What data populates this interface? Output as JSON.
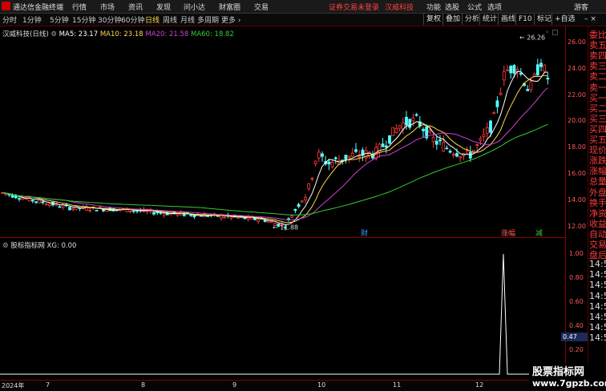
{
  "menubar": {
    "app_name": "通达信金融终端",
    "menus": [
      "行情",
      "市场",
      "资讯",
      "发现",
      "问小达",
      "财富圈",
      "交易"
    ],
    "alert": "证券交易未登录",
    "stock_link": "汉威科技",
    "right_menus": [
      "功能",
      "选股",
      "公式",
      "选项",
      "游客"
    ]
  },
  "toolbar": {
    "periods": [
      "分时",
      "1分钟",
      "5分钟",
      "15分钟",
      "30分钟",
      "60分钟",
      "日线",
      "周线",
      "月线",
      "多周期",
      "更多 ›"
    ],
    "active": "日线",
    "right_buttons": [
      "复权",
      "叠加",
      "分析",
      "统计",
      "画线",
      "F10",
      "标记",
      "+自选"
    ]
  },
  "main_chart": {
    "title": "汉威科技(日线)",
    "ma": [
      {
        "label": "MA5: 23.17",
        "color": "#ffffff"
      },
      {
        "label": "MA10: 23.18",
        "color": "#ffd84a"
      },
      {
        "label": "MA20: 21.58",
        "color": "#d040d0"
      },
      {
        "label": "MA60: 18.82",
        "color": "#33cc33"
      }
    ],
    "high_label": "26.26",
    "low_label": "11.88",
    "price_axis": [
      "26.00",
      "24.00",
      "22.00",
      "20.00",
      "18.00",
      "16.00",
      "14.00",
      "12.00"
    ],
    "markers": [
      {
        "text": "财",
        "color": "#33a0ff"
      },
      {
        "text": "涨幅",
        "color": "#ff5a5a"
      },
      {
        "text": "减",
        "color": "#33cc33"
      }
    ]
  },
  "indicator": {
    "title": "股标指标网 XG: 0.00",
    "axis": [
      "1.00",
      "0.80",
      "0.60",
      "0.40",
      "0.20"
    ],
    "current": "0.47"
  },
  "right_panel": [
    {
      "t": "委比",
      "c": "r"
    },
    {
      "t": "卖五",
      "c": "r"
    },
    {
      "t": "卖四",
      "c": "r"
    },
    {
      "t": "卖三",
      "c": "r"
    },
    {
      "t": "卖二",
      "c": "r"
    },
    {
      "t": "卖一",
      "c": "r"
    },
    {
      "t": "买一",
      "c": "r"
    },
    {
      "t": "买二",
      "c": "r"
    },
    {
      "t": "买三",
      "c": "r"
    },
    {
      "t": "买四",
      "c": "r"
    },
    {
      "t": "买五",
      "c": "r"
    },
    {
      "t": "现价",
      "c": "r"
    },
    {
      "t": "涨跌",
      "c": "r"
    },
    {
      "t": "涨幅",
      "c": "r"
    },
    {
      "t": "总量",
      "c": "r"
    },
    {
      "t": "外盘",
      "c": "r"
    },
    {
      "t": "换手",
      "c": "r"
    },
    {
      "t": "净资",
      "c": "r"
    },
    {
      "t": "收益",
      "c": "r"
    },
    {
      "t": "自动",
      "c": "r"
    },
    {
      "t": "交易",
      "c": "r"
    },
    {
      "t": "盘后",
      "c": "r"
    },
    {
      "t": "14:50",
      "c": "w"
    },
    {
      "t": "14:50",
      "c": "w"
    },
    {
      "t": "14:50",
      "c": "w"
    },
    {
      "t": "14:50",
      "c": "w"
    },
    {
      "t": "14:50",
      "c": "w"
    },
    {
      "t": "14:50",
      "c": "w"
    },
    {
      "t": "14:50",
      "c": "w"
    },
    {
      "t": "14:50",
      "c": "w"
    }
  ],
  "dates": [
    "2024年",
    "7",
    "8",
    "9",
    "10",
    "11",
    "12"
  ],
  "watermark": {
    "line1": "股票指标网",
    "line2": "www.7gpzb.com"
  }
}
